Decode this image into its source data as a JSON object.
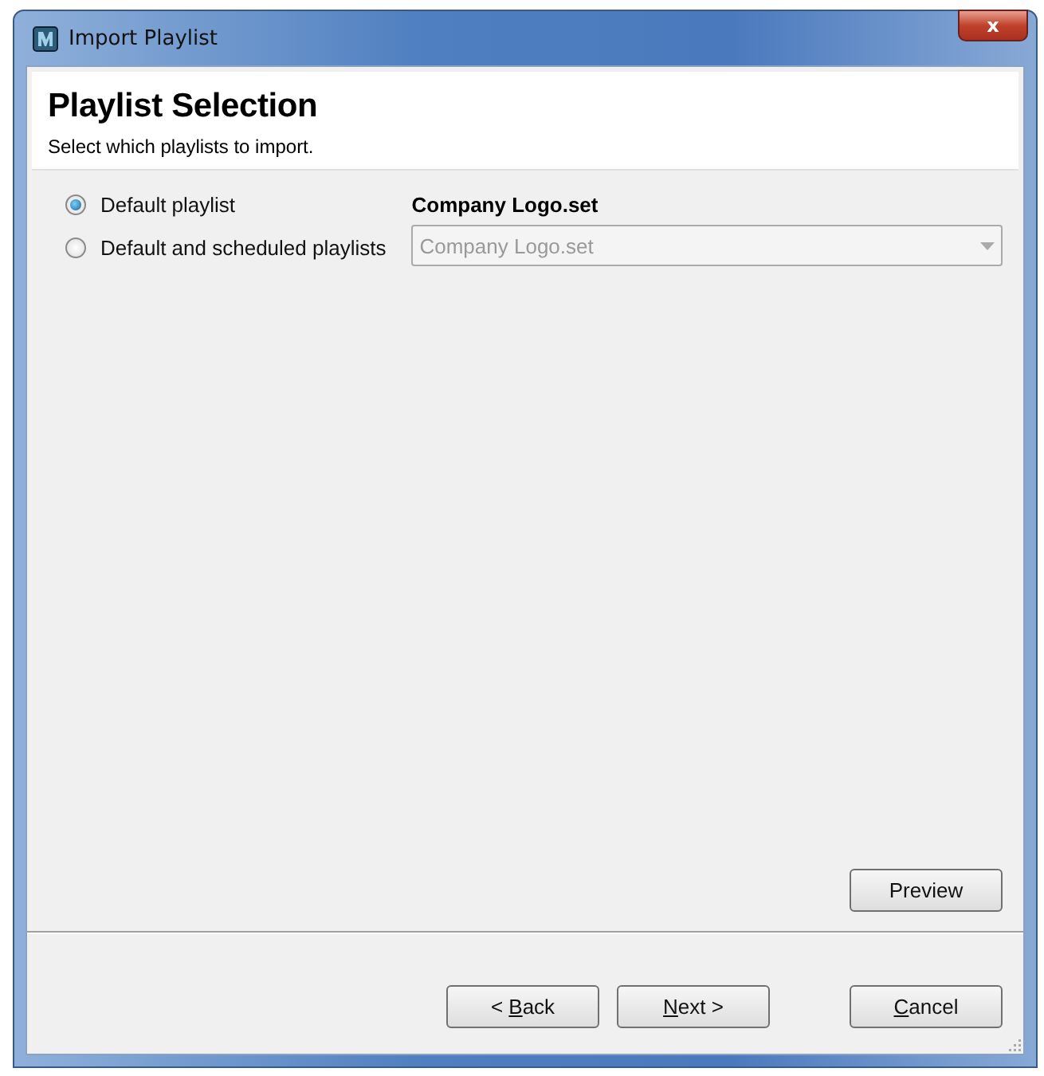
{
  "window": {
    "title": "Import Playlist",
    "close": "x"
  },
  "header": {
    "title": "Playlist Selection",
    "subtitle": "Select which playlists to import."
  },
  "options": [
    {
      "label": "Default playlist",
      "selected": true
    },
    {
      "label": "Default and scheduled playlists",
      "selected": false
    }
  ],
  "playlist": {
    "label": "Company Logo.set",
    "value": "Company Logo.set",
    "disabled": true
  },
  "preview_button": "Preview",
  "buttons": [
    {
      "before": "< ",
      "key": "B",
      "after": "ack"
    },
    {
      "key": "N",
      "after": "ext >"
    },
    {
      "key": "C",
      "after": "ancel"
    }
  ]
}
